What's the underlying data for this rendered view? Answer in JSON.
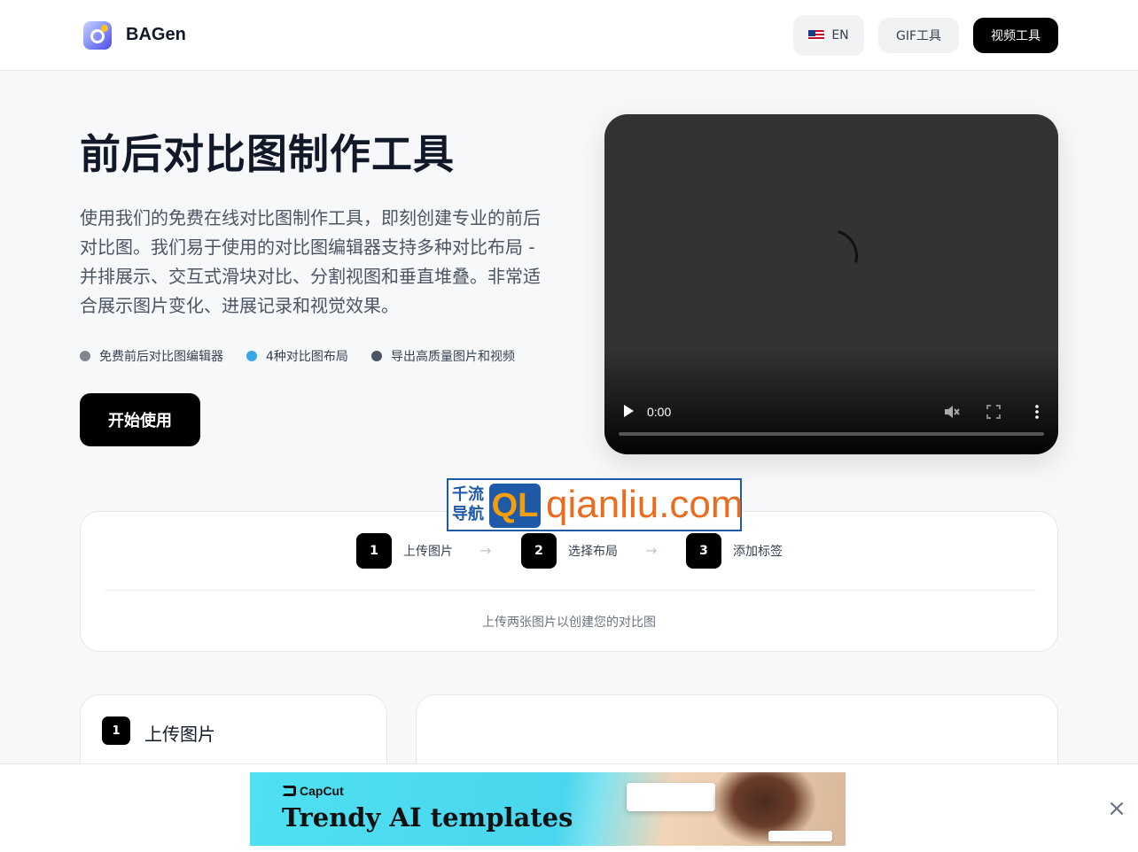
{
  "header": {
    "brand": "BAGen",
    "language_label": "EN",
    "gif_tool_label": "GIF工具",
    "video_tool_label": "视频工具"
  },
  "hero": {
    "title": "前后对比图制作工具",
    "description": "使用我们的免费在线对比图制作工具，即刻创建专业的前后对比图。我们易于使用的对比图编辑器支持多种对比布局 - 并排展示、交互式滑块对比、分割视图和垂直堆叠。非常适合展示图片变化、进展记录和视觉效果。",
    "features": [
      {
        "label": "免费前后对比图编辑器",
        "color": "#808590"
      },
      {
        "label": "4种对比图布局",
        "color": "#38a7e8"
      },
      {
        "label": "导出高质量图片和视频",
        "color": "#4b5563"
      }
    ],
    "start_button": "开始使用"
  },
  "video": {
    "time": "0:00"
  },
  "watermark": {
    "line1": "千流",
    "line2": "导航",
    "badge": "QL",
    "domain": "qianliu.com"
  },
  "steps": {
    "items": [
      {
        "num": "1",
        "label": "上传图片"
      },
      {
        "num": "2",
        "label": "选择布局"
      },
      {
        "num": "3",
        "label": "添加标签"
      }
    ],
    "arrow": "→",
    "hint": "上传两张图片以创建您的对比图"
  },
  "upload_panel": {
    "num": "1",
    "label": "上传图片"
  },
  "ad": {
    "brand": "CapCut",
    "tagline": "Trendy AI templates",
    "close": "×"
  }
}
